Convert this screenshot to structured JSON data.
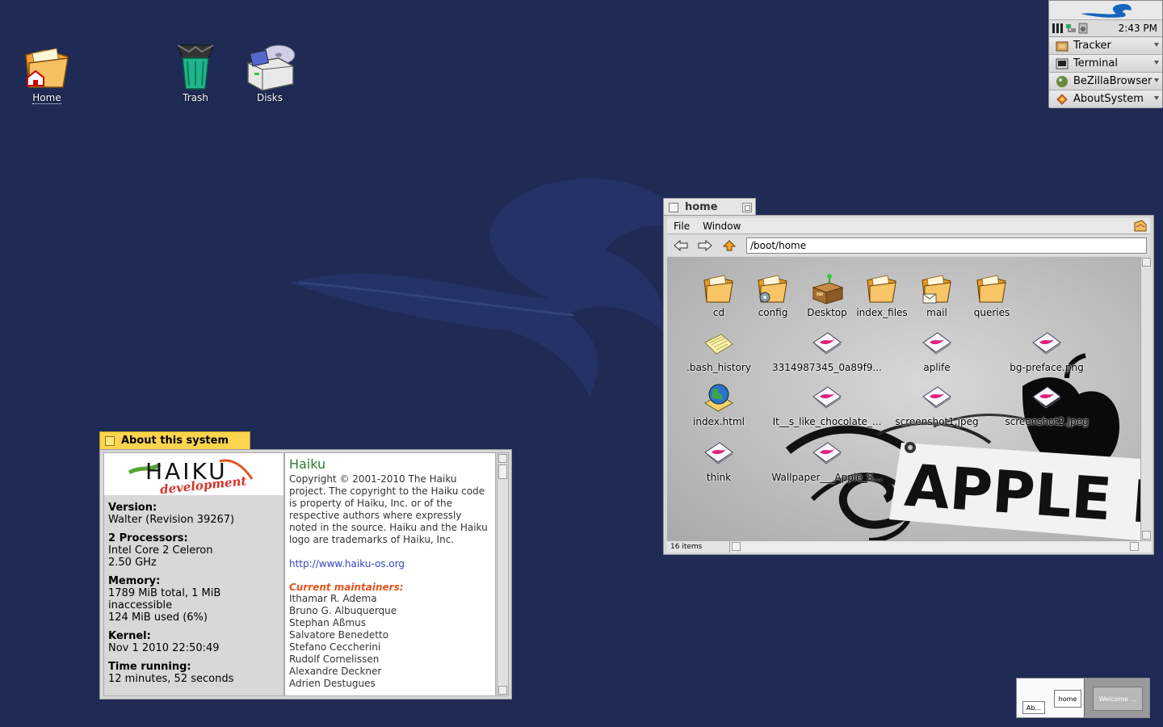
{
  "desktop": {
    "icons": [
      {
        "label": "Home"
      },
      {
        "label": "Trash"
      },
      {
        "label": "Disks"
      }
    ]
  },
  "deskbar": {
    "clock": "2:43 PM",
    "items": [
      {
        "label": "Tracker"
      },
      {
        "label": "Terminal"
      },
      {
        "label": "BeZillaBrowser"
      },
      {
        "label": "AboutSystem"
      }
    ]
  },
  "home_window": {
    "title": "home",
    "menus": [
      "File",
      "Window"
    ],
    "path": "/boot/home",
    "status": "16 items",
    "files": [
      {
        "label": "cd",
        "kind": "folder"
      },
      {
        "label": "config",
        "kind": "folder-gear"
      },
      {
        "label": "Desktop",
        "kind": "desk"
      },
      {
        "label": "index_files",
        "kind": "folder"
      },
      {
        "label": "mail",
        "kind": "folder-mail"
      },
      {
        "label": "queries",
        "kind": "folder"
      },
      {
        "label": ".bash_history",
        "kind": "text"
      },
      {
        "label": "3314987345_0a89f9...",
        "kind": "image"
      },
      {
        "label": "aplife",
        "kind": "image"
      },
      {
        "label": "bg-preface.png",
        "kind": "image"
      },
      {
        "label": "index.html",
        "kind": "globe"
      },
      {
        "label": "It__s_like_chocolate_...",
        "kind": "image"
      },
      {
        "label": "screenshot1.jpeg",
        "kind": "image"
      },
      {
        "label": "screenshot2.jpeg",
        "kind": "image"
      },
      {
        "label": "think",
        "kind": "image"
      },
      {
        "label": "Wallpaper___Apple_S...",
        "kind": "image"
      }
    ],
    "wallpaper_text": "APPLE LI"
  },
  "about_window": {
    "title": "About this system",
    "logo_text": "HAIKU",
    "logo_sub": "development",
    "info": [
      {
        "label": "Version:",
        "lines": [
          "Walter (Revision 39267)"
        ]
      },
      {
        "label": "2 Processors:",
        "lines": [
          "Intel Core 2 Celeron",
          "2.50 GHz"
        ]
      },
      {
        "label": "Memory:",
        "lines": [
          "1789 MiB total, 1 MiB inaccessible",
          "124 MiB used (6%)"
        ]
      },
      {
        "label": "Kernel:",
        "lines": [
          "Nov  1 2010 22:50:49"
        ]
      },
      {
        "label": "Time running:",
        "lines": [
          "12 minutes, 52 seconds"
        ]
      }
    ],
    "app_name": "Haiku",
    "copyright": "Copyright © 2001-2010 The Haiku project. The copyright to the Haiku code is property of Haiku, Inc. or of the respective authors where expressly noted in the source. Haiku and the Haiku logo are trademarks of Haiku, Inc.",
    "url": "http://www.haiku-os.org",
    "maintainers_title": "Current maintainers:",
    "maintainers": [
      "Ithamar R. Adema",
      "Bruno G. Albuquerque",
      "Stephan Aßmus",
      "Salvatore Benedetto",
      "Stefano Ceccherini",
      "Rudolf Cornelissen",
      "Alexandre Deckner",
      "Adrien Destugues"
    ]
  },
  "workspaces": {
    "windows": [
      "home",
      "Ab...",
      "Welcome ..."
    ]
  }
}
